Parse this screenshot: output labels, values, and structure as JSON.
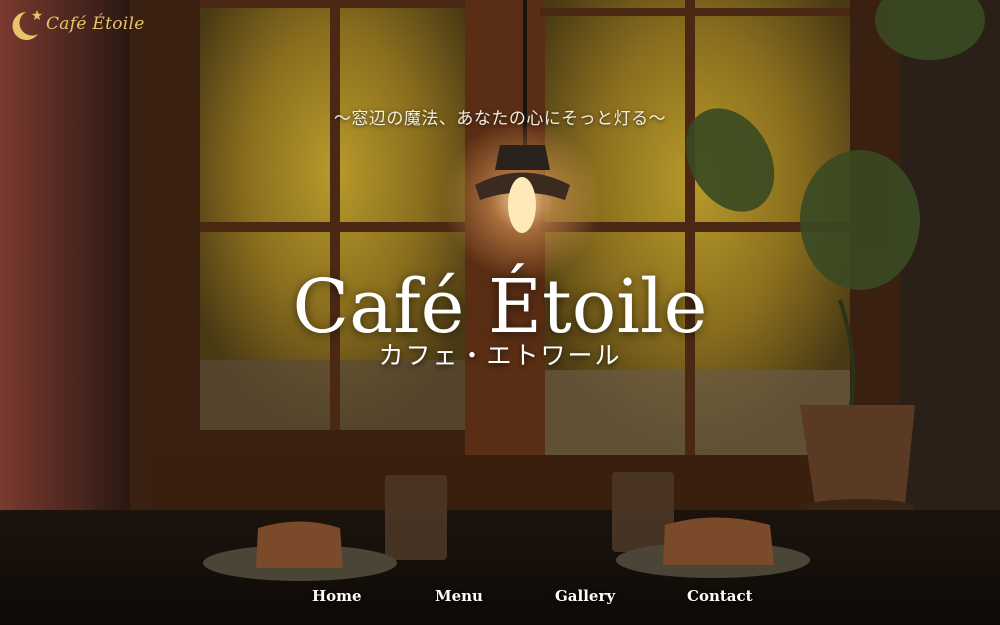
{
  "brand": {
    "logo_text": "Café Étoile",
    "accent_color": "#e9c56a"
  },
  "hero": {
    "tagline": "〜窓辺の魔法、あなたの心にそっと灯る〜",
    "title": "Café Étoile",
    "subtitle": "カフェ・エトワール"
  },
  "nav": {
    "home": "Home",
    "menu": "Menu",
    "gallery": "Gallery",
    "contact": "Contact"
  }
}
